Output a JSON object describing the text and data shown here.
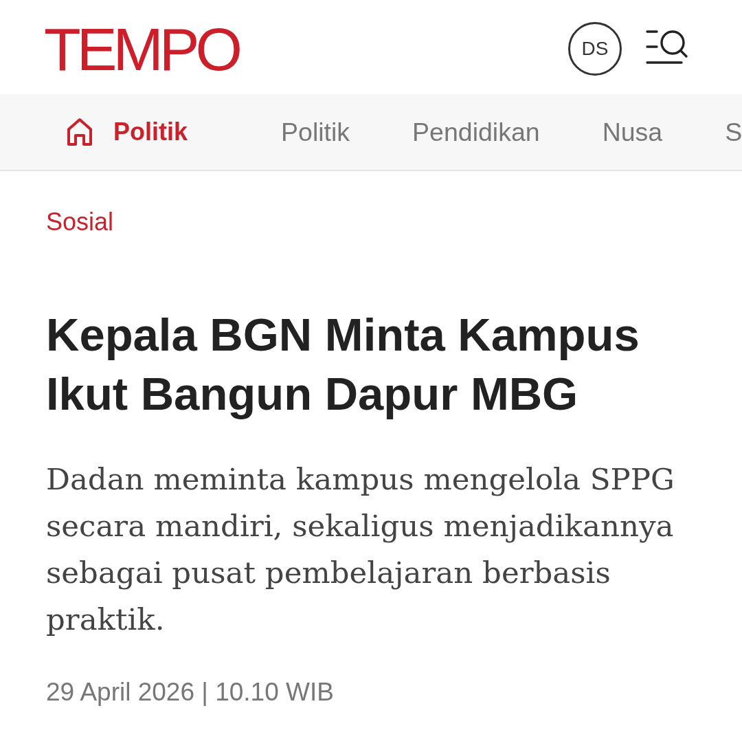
{
  "header": {
    "logo": "TEMPO",
    "avatar": {
      "initials": "DS"
    }
  },
  "nav": {
    "items": [
      {
        "kind": "home",
        "label": "Politik",
        "selected": true
      },
      {
        "kind": "link",
        "label": "Politik",
        "selected": false
      },
      {
        "kind": "link",
        "label": "Pendidikan",
        "selected": false
      },
      {
        "kind": "link",
        "label": "Nusa",
        "selected": false
      },
      {
        "kind": "link",
        "label": "S",
        "selected": false
      }
    ]
  },
  "article": {
    "category": "Sosial",
    "headline": "Kepala BGN Minta Kampus Ikut Bangun Dapur MBG",
    "summary": "Dadan meminta kampus mengelola SPPG secara mandiri, sekaligus menjadikannya sebagai pusat pembelajaran berbasis praktik.",
    "date": "29 April 2026 | 10.10 WIB"
  }
}
